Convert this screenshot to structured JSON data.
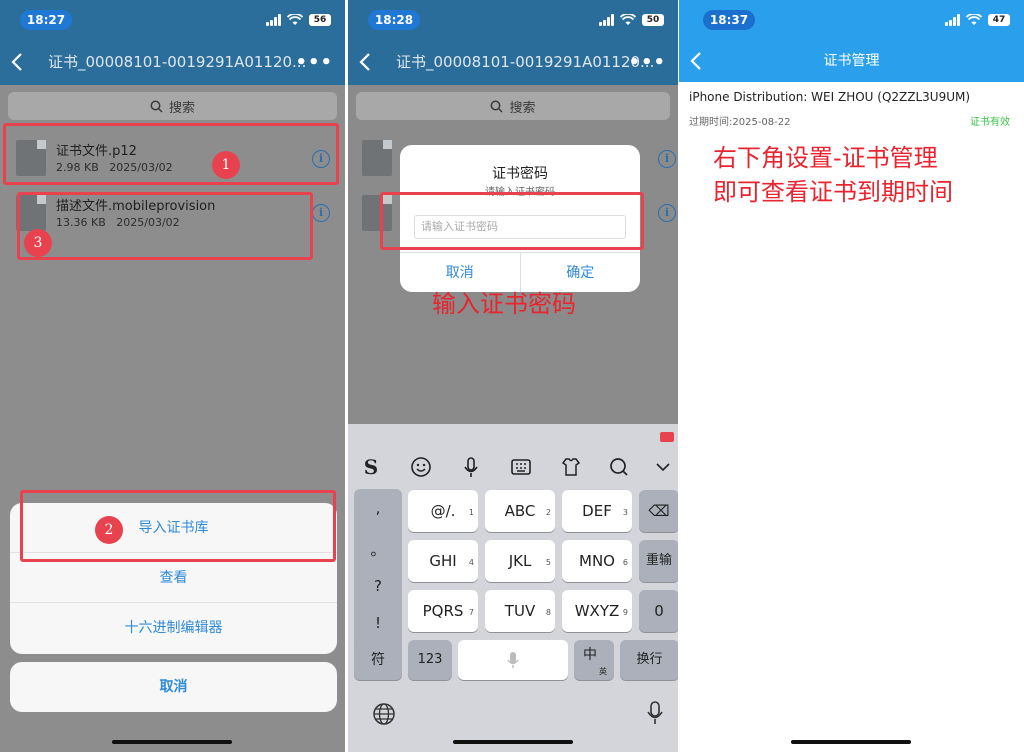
{
  "colors": {
    "blue_nav": "#2c8fd9",
    "overlay_nav": "#2a6f9e",
    "dim_bg": "#8b8b8b",
    "accent": "#2f8ad8",
    "red": "#e8424f",
    "green": "#3cc24a"
  },
  "panel1": {
    "time": "18:27",
    "battery": "56",
    "title": "证书_00008101-0019291A01120...",
    "more": "•••",
    "search_placeholder": "搜索",
    "files": [
      {
        "name": "证书文件.p12",
        "size": "2.98 KB",
        "date": "2025/03/02"
      },
      {
        "name": "描述文件.mobileprovision",
        "size": "13.36 KB",
        "date": "2025/03/02"
      }
    ],
    "badges": [
      "1",
      "2",
      "3"
    ],
    "sheet_items": [
      "导入证书库",
      "查看",
      "十六进制编辑器"
    ],
    "cancel": "取消"
  },
  "panel2": {
    "time": "18:28",
    "battery": "50",
    "title": "证书_00008101-0019291A01120...",
    "more": "•••",
    "search_placeholder": "搜索",
    "dialog": {
      "title": "证书密码",
      "subtitle": "请输入证书密码",
      "placeholder": "请输入证书密码",
      "cancel": "取消",
      "confirm": "确定"
    },
    "annotation": "输入证书密码",
    "keyboard": {
      "side": [
        ",",
        "。",
        "?",
        "!"
      ],
      "rows": [
        [
          {
            "label": "@/.",
            "sup": "1"
          },
          {
            "label": "ABC",
            "sup": "2"
          },
          {
            "label": "DEF",
            "sup": "3"
          }
        ],
        [
          {
            "label": "GHI",
            "sup": "4"
          },
          {
            "label": "JKL",
            "sup": "5"
          },
          {
            "label": "MNO",
            "sup": "6"
          }
        ],
        [
          {
            "label": "PQRS",
            "sup": "7"
          },
          {
            "label": "TUV",
            "sup": "8"
          },
          {
            "label": "WXYZ",
            "sup": "9"
          }
        ]
      ],
      "delete": "⌫",
      "reenter": "重输",
      "zero": "0",
      "symbol": "符",
      "num": "123",
      "zh": "中",
      "zh_sub": "英",
      "newline": "换行"
    }
  },
  "panel3": {
    "time": "18:37",
    "battery": "47",
    "title": "证书管理",
    "cert_name": "iPhone Distribution: WEI ZHOU (Q2ZZL3U9UM)",
    "expiry": "过期时间:2025-08-22",
    "status": "证书有效",
    "annotation_line1": "右下角设置-证书管理",
    "annotation_line2": "即可查看证书到期时间"
  }
}
